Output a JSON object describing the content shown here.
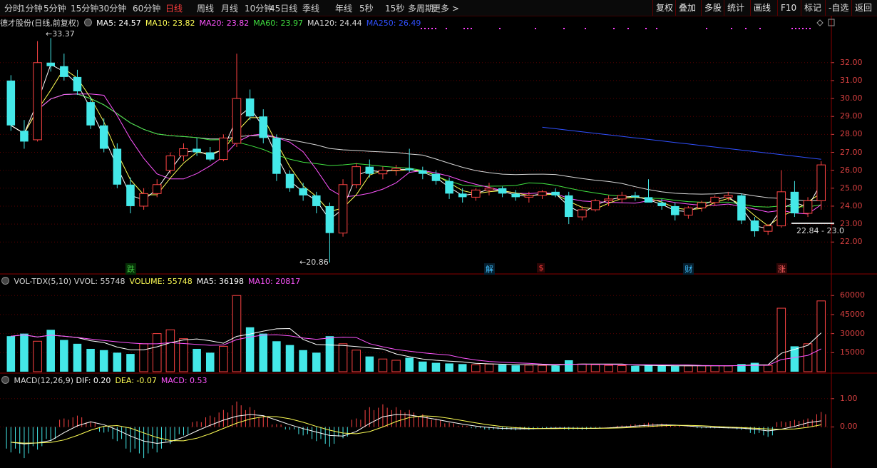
{
  "toolbar": {
    "periods": [
      "分时",
      "1分钟",
      "5分钟",
      "15分钟",
      "30分钟",
      "60分钟",
      "日线",
      "周线",
      "月线",
      "10分钟",
      "45日线",
      "季线",
      "年线",
      "5秒",
      "15秒",
      "多周期",
      "更多 >"
    ],
    "active_period": "日线",
    "right_buttons": [
      "复权",
      "叠加",
      "多股",
      "统计",
      "画线",
      "F10",
      "标记",
      "-自选",
      "返回"
    ]
  },
  "price_panel": {
    "title": "德才股份(日线,前复权)",
    "ma": [
      {
        "label": "MA5: 24.57",
        "color": "#ffffff"
      },
      {
        "label": "MA10: 23.82",
        "color": "#ffff55"
      },
      {
        "label": "MA20: 23.82",
        "color": "#ff55ff"
      },
      {
        "label": "MA60: 23.97",
        "color": "#40e040"
      },
      {
        "label": "MA120: 24.44",
        "color": "#d8d8d8"
      },
      {
        "label": "MA250: 26.49",
        "color": "#3050ff"
      }
    ],
    "high_label": "33.37",
    "low_label": "20.86",
    "range_label": "22.84 - 23.0",
    "markers": [
      {
        "text": "跌",
        "color": "#40c040",
        "bg": "#063006",
        "idx": 9
      },
      {
        "text": "解",
        "color": "#40c0ff",
        "bg": "#062030",
        "idx": 36
      },
      {
        "text": "$",
        "color": "#ff4040",
        "bg": "#300606",
        "idx": 40
      },
      {
        "text": "财",
        "color": "#40c0ff",
        "bg": "#062030",
        "idx": 51
      },
      {
        "text": "涨",
        "color": "#ff6060",
        "bg": "#300606",
        "idx": 58
      }
    ]
  },
  "vol_panel": {
    "title": "VOL-TDX(5,10)",
    "items": [
      {
        "label": "VVOL: 55748",
        "color": "#d8d8d8"
      },
      {
        "label": "VOLUME: 55748",
        "color": "#ffff55"
      },
      {
        "label": "MA5: 36198",
        "color": "#ffffff"
      },
      {
        "label": "MA10: 20817",
        "color": "#ff55ff"
      }
    ]
  },
  "macd_panel": {
    "title": "MACD(12,26,9)",
    "items": [
      {
        "label": "DIF: 0.20",
        "color": "#ffffff"
      },
      {
        "label": "DEA: -0.07",
        "color": "#ffff55"
      },
      {
        "label": "MACD: 0.53",
        "color": "#ff55ff"
      }
    ]
  },
  "colors": {
    "up": "#ff4444",
    "down": "#44e8e8",
    "grid": "#5a0000",
    "axis": "#d84040"
  },
  "chart_data": [
    {
      "type": "candlestick",
      "title": "德才股份(日线,前复权)",
      "y_ticks": [
        22.0,
        23.0,
        24.0,
        25.0,
        26.0,
        27.0,
        28.0,
        29.0,
        30.0,
        31.0,
        32.0
      ],
      "ylim": [
        20.3,
        33.9
      ],
      "ohlc": [
        [
          31.0,
          31.3,
          28.2,
          28.5
        ],
        [
          28.2,
          28.8,
          27.2,
          27.6
        ],
        [
          27.7,
          33.2,
          27.6,
          32.0
        ],
        [
          32.0,
          33.37,
          31.5,
          31.8
        ],
        [
          31.8,
          32.5,
          31.0,
          31.2
        ],
        [
          31.2,
          31.6,
          30.2,
          30.4
        ],
        [
          29.8,
          30.1,
          28.3,
          28.5
        ],
        [
          28.5,
          28.9,
          27.0,
          27.2
        ],
        [
          27.2,
          27.5,
          25.0,
          25.2
        ],
        [
          25.2,
          25.6,
          23.6,
          24.0
        ],
        [
          24.0,
          25.0,
          23.8,
          24.7
        ],
        [
          24.7,
          25.5,
          24.5,
          25.2
        ],
        [
          26.0,
          27.0,
          25.8,
          26.8
        ],
        [
          26.8,
          27.5,
          26.5,
          27.2
        ],
        [
          27.2,
          27.8,
          26.8,
          27.0
        ],
        [
          27.0,
          27.3,
          26.5,
          26.6
        ],
        [
          26.6,
          28.0,
          26.5,
          27.8
        ],
        [
          27.5,
          32.5,
          27.3,
          30.0
        ],
        [
          30.0,
          30.5,
          28.8,
          29.0
        ],
        [
          29.0,
          29.4,
          27.5,
          27.8
        ],
        [
          27.8,
          28.0,
          25.4,
          25.8
        ],
        [
          25.8,
          26.0,
          24.8,
          25.0
        ],
        [
          25.0,
          25.3,
          24.3,
          24.6
        ],
        [
          24.6,
          24.8,
          23.6,
          24.0
        ],
        [
          24.0,
          24.2,
          20.86,
          22.5
        ],
        [
          22.5,
          25.5,
          22.3,
          25.2
        ],
        [
          25.2,
          26.4,
          25.0,
          26.2
        ],
        [
          26.2,
          26.6,
          25.6,
          25.8
        ],
        [
          25.8,
          26.2,
          25.5,
          26.0
        ],
        [
          26.0,
          26.3,
          25.7,
          26.1
        ],
        [
          26.1,
          27.2,
          25.9,
          26.0
        ],
        [
          26.0,
          26.2,
          25.5,
          25.8
        ],
        [
          25.8,
          26.0,
          25.2,
          25.4
        ],
        [
          25.4,
          25.6,
          24.4,
          24.7
        ],
        [
          24.7,
          25.0,
          24.2,
          24.5
        ],
        [
          24.5,
          25.0,
          24.3,
          24.9
        ],
        [
          24.9,
          25.3,
          24.6,
          25.0
        ],
        [
          25.0,
          25.1,
          24.5,
          24.7
        ],
        [
          24.7,
          24.9,
          24.3,
          24.5
        ],
        [
          24.5,
          24.8,
          24.2,
          24.6
        ],
        [
          24.6,
          24.9,
          24.4,
          24.8
        ],
        [
          24.8,
          25.0,
          24.5,
          24.6
        ],
        [
          24.6,
          24.8,
          23.0,
          23.4
        ],
        [
          23.4,
          24.0,
          23.2,
          23.8
        ],
        [
          23.8,
          24.4,
          23.7,
          24.3
        ],
        [
          24.3,
          24.6,
          24.0,
          24.4
        ],
        [
          24.4,
          24.8,
          24.2,
          24.6
        ],
        [
          24.6,
          24.8,
          24.3,
          24.5
        ],
        [
          24.5,
          25.5,
          24.3,
          24.2
        ],
        [
          24.2,
          24.4,
          23.8,
          24.0
        ],
        [
          24.0,
          24.2,
          23.2,
          23.5
        ],
        [
          23.5,
          24.0,
          23.3,
          23.9
        ],
        [
          23.9,
          24.3,
          23.7,
          24.2
        ],
        [
          24.2,
          24.6,
          24.0,
          24.5
        ],
        [
          24.5,
          24.8,
          24.3,
          24.6
        ],
        [
          24.6,
          24.7,
          23.0,
          23.2
        ],
        [
          23.2,
          23.4,
          22.3,
          22.6
        ],
        [
          22.6,
          23.0,
          22.4,
          22.9
        ],
        [
          22.9,
          26.0,
          22.8,
          24.8
        ],
        [
          24.8,
          25.4,
          23.4,
          23.6
        ],
        [
          23.6,
          24.5,
          23.4,
          24.3
        ],
        [
          24.3,
          26.5,
          23.8,
          26.3
        ]
      ]
    },
    {
      "type": "bar",
      "title": "VOL-TDX(5,10)",
      "y_ticks": [
        15000,
        30000,
        45000,
        60000
      ],
      "ylim": [
        0,
        68000
      ],
      "values": [
        28000,
        30000,
        24000,
        33000,
        25000,
        22000,
        18000,
        17000,
        15000,
        14000,
        22000,
        30000,
        33000,
        26000,
        18000,
        15000,
        20000,
        60000,
        35000,
        30000,
        24000,
        21000,
        17000,
        15000,
        28000,
        22000,
        17000,
        12000,
        10000,
        9000,
        11000,
        8000,
        7000,
        6500,
        6000,
        5500,
        6000,
        5500,
        5000,
        5200,
        5000,
        4800,
        9000,
        6000,
        5500,
        5000,
        4800,
        4600,
        5000,
        4500,
        4400,
        4600,
        4700,
        4800,
        4600,
        6000,
        7000,
        5000,
        50000,
        20000,
        22000,
        55748
      ]
    },
    {
      "type": "bar",
      "title": "MACD(12,26,9)",
      "y_ticks": [
        0.0,
        1.0
      ],
      "ylim": [
        -1.4,
        1.6
      ],
      "values": [
        -0.9,
        -1.1,
        -0.8,
        -0.5,
        0.3,
        0.4,
        0.2,
        -0.2,
        -0.5,
        -0.9,
        -1.1,
        -0.9,
        -0.6,
        -0.3,
        0.2,
        0.4,
        0.6,
        0.9,
        0.7,
        0.4,
        0.1,
        -0.1,
        -0.3,
        -0.5,
        -0.7,
        -0.4,
        0.3,
        0.7,
        0.8,
        0.7,
        0.6,
        0.45,
        0.3,
        0.15,
        0.05,
        -0.05,
        -0.1,
        -0.1,
        -0.12,
        -0.1,
        -0.05,
        -0.05,
        -0.1,
        -0.1,
        -0.05,
        0.0,
        0.05,
        0.1,
        0.15,
        0.12,
        0.05,
        0.0,
        -0.05,
        -0.05,
        -0.05,
        -0.1,
        -0.25,
        -0.35,
        0.2,
        0.25,
        0.3,
        0.53
      ]
    }
  ]
}
